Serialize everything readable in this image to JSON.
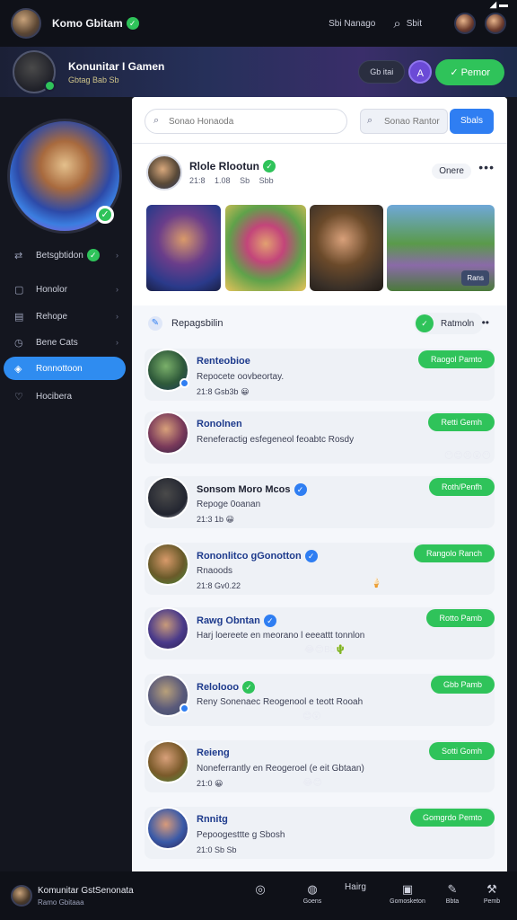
{
  "topbar": {
    "title": "Komo Gbitam",
    "link": "Sbi Nanago",
    "exit": "Sbit"
  },
  "hero": {
    "name": "Konunitar I Gamen",
    "sub": "Gbtag Bab Sb",
    "pill": "Gb itai",
    "action": "Pemor"
  },
  "sidebar": {
    "items": [
      {
        "icon": "share-icon",
        "label": "Betsgbtidon",
        "verified": true
      },
      {
        "icon": "calendar-icon",
        "label": "Honolor"
      },
      {
        "icon": "document-icon",
        "label": "Rehope"
      },
      {
        "icon": "clock-icon",
        "label": "Bene Cats"
      },
      {
        "icon": "compass-icon",
        "label": "Ronnottoon",
        "active": true
      },
      {
        "icon": "heart-icon",
        "label": "Hocibera"
      }
    ]
  },
  "search": {
    "placeholder": "Sonao Honaoda",
    "filter_placeholder": "Sonao Rantor",
    "button": "Sbals"
  },
  "post": {
    "name": "Rlole Rlootun",
    "stats": [
      "21:8",
      "1.08",
      "Sb",
      "Sbb"
    ],
    "open_label": "Onere",
    "thumb_tag": "Rans"
  },
  "section": {
    "title": "Repagsbilin",
    "remain": "Ratmoln"
  },
  "list": [
    {
      "name": "Renteobioe",
      "desc": "Repocete oovbeortay.",
      "stats": "21:8  Gsb3b",
      "button": "Raogol Pamto",
      "verified": "green",
      "emoji": "😀"
    },
    {
      "name": "Ronolnen",
      "desc": "Reneferactig esfegeneol feoabtc Rosdy",
      "stats": "",
      "button": "Retti Gemh",
      "verified": "",
      "emoji": "😶😊😣😮😶"
    },
    {
      "name": "Sonsom Moro Mcos",
      "desc": "Repoge 0oanan",
      "stats": "21:3  1b",
      "button": "Roth/Penfh",
      "verified": "blue",
      "emoji": "😀"
    },
    {
      "name": "Rononlitco gGonotton",
      "desc": "Rnaoods",
      "stats": "21:8  Gv0.22",
      "button": "Rangolo Ranch",
      "verified": "blue",
      "emoji": "🍦"
    },
    {
      "name": "Rawg Obntan",
      "desc": "Harj loereete en meorano l eeeattt tonnlon",
      "stats": "",
      "button": "Rotto Pamb",
      "verified": "blue",
      "emoji": "😂😊Bb🌵"
    },
    {
      "name": "Relolooo",
      "desc": "Reny Sonenaec Reogenool e teott Rooah",
      "stats": "",
      "button": "Gbb Pamb",
      "verified": "green",
      "emoji": "😊😮"
    },
    {
      "name": "Reieng",
      "desc": "Noneferrantly en Reogeroel (e eit Gbtaan)",
      "stats": "21:0  😀",
      "button": "Sotti Gomh",
      "verified": "",
      "emoji": "😂😊"
    },
    {
      "name": "Rnnitg",
      "desc": "Pepoogesttte g Sbosh",
      "stats": "21:0  Sb  Sb",
      "button": "Gomgrdo Pemto",
      "verified": "",
      "emoji": ""
    }
  ],
  "bottombar": {
    "name": "Komunitar GstSenonata",
    "sub": "Ramo Gbitaaa",
    "items": [
      {
        "icon": "record-icon",
        "label": ""
      },
      {
        "icon": "notification-icon",
        "label": "Goens"
      },
      {
        "icon": "text-icon",
        "label": "Hairg"
      },
      {
        "icon": "controller-icon",
        "label": "Gomosketon"
      },
      {
        "icon": "edit-icon",
        "label": "Bbta"
      },
      {
        "icon": "tools-icon",
        "label": "Pemb"
      }
    ]
  },
  "colors": {
    "accent": "#2f7ef2",
    "success": "#2fc35a",
    "sidebar_bg": "#14161f",
    "active_nav": "#2f8cf0"
  }
}
